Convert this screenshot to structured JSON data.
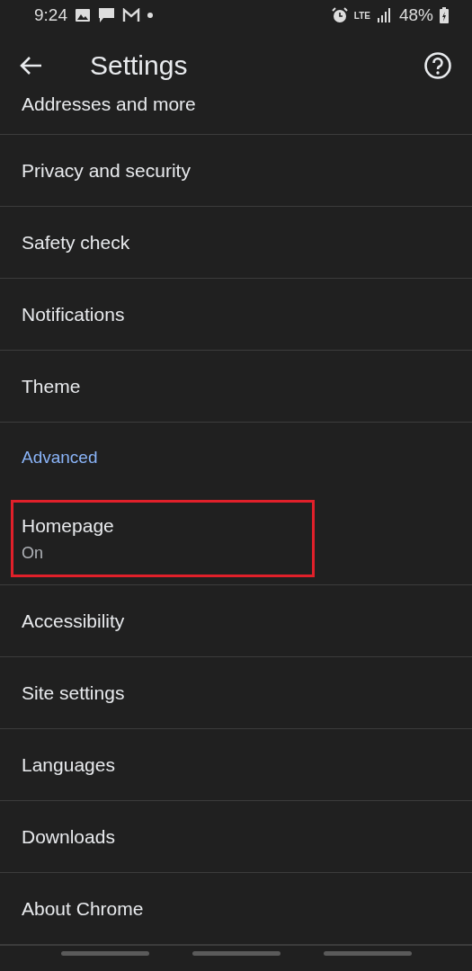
{
  "status_bar": {
    "time": "9:24",
    "network": "LTE",
    "battery": "48%"
  },
  "toolbar": {
    "title": "Settings"
  },
  "items": [
    {
      "kind": "partial",
      "label": "Addresses and more",
      "highlighted": false
    },
    {
      "kind": "item",
      "label": "Privacy and security",
      "highlighted": false
    },
    {
      "kind": "item",
      "label": "Safety check",
      "highlighted": false
    },
    {
      "kind": "item",
      "label": "Notifications",
      "highlighted": false
    },
    {
      "kind": "item",
      "label": "Theme",
      "highlighted": false
    },
    {
      "kind": "header",
      "label": "Advanced",
      "highlighted": false
    },
    {
      "kind": "item",
      "label": "Homepage",
      "summary": "On",
      "highlighted": true
    },
    {
      "kind": "item",
      "label": "Accessibility",
      "highlighted": false
    },
    {
      "kind": "item",
      "label": "Site settings",
      "highlighted": false
    },
    {
      "kind": "item",
      "label": "Languages",
      "highlighted": false
    },
    {
      "kind": "item",
      "label": "Downloads",
      "highlighted": false
    },
    {
      "kind": "item",
      "label": "About Chrome",
      "highlighted": false
    }
  ]
}
